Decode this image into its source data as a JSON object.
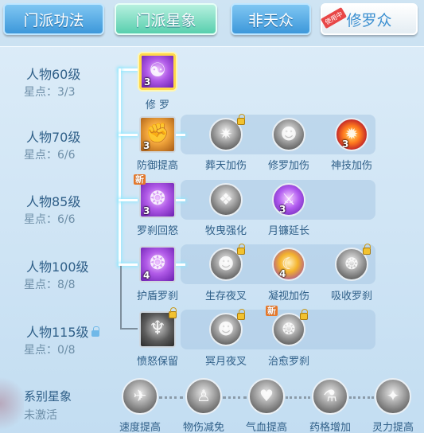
{
  "tabs": [
    {
      "label": "门派功法"
    },
    {
      "label": "门派星象"
    },
    {
      "label": "非天众"
    },
    {
      "label": "修罗众",
      "ribbon": "使用中"
    }
  ],
  "levels": [
    {
      "title": "人物60级",
      "stars": "星点：3/3"
    },
    {
      "title": "人物70级",
      "stars": "星点：6/6"
    },
    {
      "title": "人物85级",
      "stars": "星点：6/6"
    },
    {
      "title": "人物100级",
      "stars": "星点：8/8"
    },
    {
      "title": "人物115级",
      "stars": "星点：0/8"
    }
  ],
  "skills": {
    "r60": [
      {
        "label": "修 罗",
        "count": "3",
        "icon": "asura-icon"
      }
    ],
    "r70": [
      {
        "label": "防御提高",
        "count": "3",
        "icon": "muscle-arm-icon"
      },
      {
        "label": "葬天加伤",
        "count": "",
        "icon": "dark-burst-icon"
      },
      {
        "label": "修罗加伤",
        "count": "",
        "icon": "asura-head-icon"
      },
      {
        "label": "神技加伤",
        "count": "3",
        "icon": "flame-icon"
      }
    ],
    "r85": [
      {
        "label": "罗刹回怒",
        "count": "3",
        "icon": "rakshasa-icon",
        "new": "新"
      },
      {
        "label": "牧曳强化",
        "count": "",
        "icon": "ghost-icon"
      },
      {
        "label": "月镰延长",
        "count": "3",
        "icon": "crescent-blade-icon"
      }
    ],
    "r100": [
      {
        "label": "护盾罗刹",
        "count": "4",
        "icon": "shield-rakshasa-icon"
      },
      {
        "label": "生存夜叉",
        "count": "",
        "icon": "yaksha-icon"
      },
      {
        "label": "凝视加伤",
        "count": "4",
        "icon": "moon-gaze-icon"
      },
      {
        "label": "吸收罗刹",
        "count": "",
        "icon": "absorb-icon"
      }
    ],
    "r115": [
      {
        "label": "愤怒保留",
        "count": "",
        "icon": "demon-icon"
      },
      {
        "label": "冥月夜叉",
        "count": "",
        "icon": "yaksha-icon"
      },
      {
        "label": "治愈罗刹",
        "count": "",
        "icon": "heal-rakshasa-icon",
        "new": "新"
      }
    ]
  },
  "series": {
    "title": "系别星象",
    "status": "未激活",
    "items": [
      {
        "label": "速度提高",
        "icon": "feather-icon"
      },
      {
        "label": "物伤减免",
        "icon": "figure-icon"
      },
      {
        "label": "气血提高",
        "icon": "heart-icon"
      },
      {
        "label": "药格增加",
        "icon": "potion-icon"
      },
      {
        "label": "灵力提高",
        "icon": "spirit-icon"
      }
    ]
  }
}
